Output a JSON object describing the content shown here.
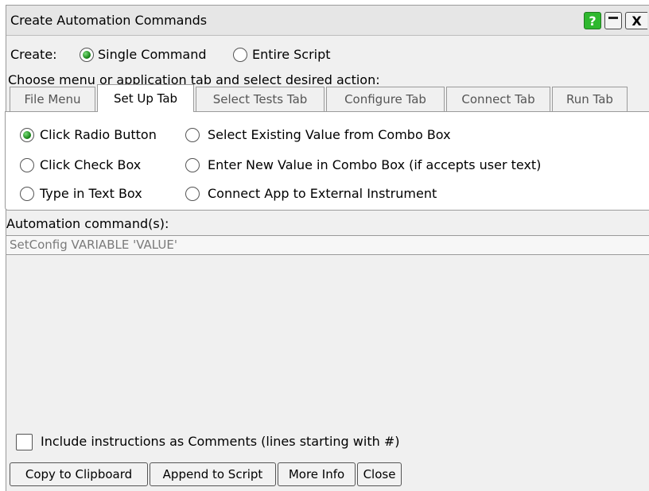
{
  "window": {
    "title": "Create Automation Commands",
    "help_label": "?",
    "close_label": "X"
  },
  "create": {
    "label": "Create:",
    "options": [
      "Single Command",
      "Entire Script"
    ],
    "selected": "Single Command"
  },
  "instruction": "Choose menu or application tab and select desired action:",
  "tabs": [
    {
      "label": "File Menu",
      "active": false
    },
    {
      "label": "Set Up Tab",
      "active": true
    },
    {
      "label": "Select Tests Tab",
      "active": false
    },
    {
      "label": "Configure Tab",
      "active": false
    },
    {
      "label": "Connect Tab",
      "active": false
    },
    {
      "label": "Run Tab",
      "active": false
    }
  ],
  "actions": {
    "left": [
      "Click Radio Button",
      "Click Check Box",
      "Type in Text Box"
    ],
    "right": [
      "Select Existing Value from Combo Box",
      "Enter New Value in Combo Box (if accepts user text)",
      "Connect App to External Instrument"
    ],
    "selected": "Click Radio Button"
  },
  "command": {
    "label": "Automation command(s):",
    "value": "SetConfig VARIABLE 'VALUE'"
  },
  "comments_checkbox": {
    "label": "Include instructions as Comments (lines starting with #)",
    "checked": false
  },
  "buttons": [
    "Copy to Clipboard",
    "Append to Script",
    "More Info",
    "Close"
  ],
  "colors": {
    "accent_green": "#2eb82e",
    "window_bg": "#f0f0f0",
    "panel_bg": "#ffffff"
  }
}
